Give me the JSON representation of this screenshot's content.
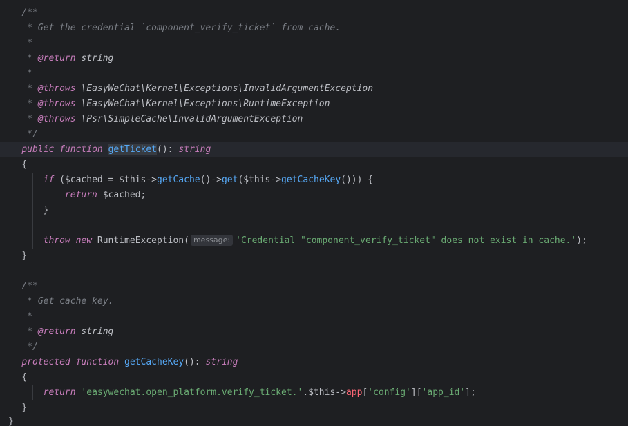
{
  "editor": {
    "language": "PHP",
    "doc1": {
      "open": "/**",
      "summary": " * Get the credential `component_verify_ticket` from cache.",
      "blank": " *",
      "star": " * ",
      "return_tag": "@return",
      "return_type": " string",
      "throws_tag": "@throws",
      "throws1": " \\EasyWeChat\\Kernel\\Exceptions\\InvalidArgumentException",
      "throws2": " \\EasyWeChat\\Kernel\\Exceptions\\RuntimeException",
      "throws3": " \\Psr\\SimpleCache\\InvalidArgumentException",
      "close": " */"
    },
    "method1": {
      "visibility": "public",
      "function_kw": "function",
      "name": "getTicket",
      "sig_rest": "(): ",
      "return_type": "string",
      "open_brace": "{",
      "if_kw": "if",
      "if_open": " ($cached = $this->",
      "get_cache": "getCache",
      "arrow": "()->",
      "get": "get",
      "this_arrow": "($this->",
      "get_cache_key": "getCacheKey",
      "if_close": "())) {",
      "return_kw": "return",
      "return_val": " $cached;",
      "close_if": "}",
      "throw_kw": "throw",
      "new_kw": "new",
      "exception_class": "RuntimeException(",
      "param_hint": "message:",
      "message": "'Credential \"component_verify_ticket\" does not exist in cache.'",
      "throw_end": ");",
      "close_brace": "}"
    },
    "doc2": {
      "open": "/**",
      "summary": " * Get cache key.",
      "blank": " *",
      "star": " * ",
      "return_tag": "@return",
      "return_type": " string",
      "close": " */"
    },
    "method2": {
      "visibility": "protected",
      "function_kw": "function",
      "name": "getCacheKey",
      "sig_rest": "(): ",
      "return_type": "string",
      "open_brace": "{",
      "return_kw": "return",
      "key_string": "'easywechat.open_platform.verify_ticket.'",
      "concat": ".$this->",
      "app": "app",
      "lbr": "[",
      "config_key": "'config'",
      "mid": "][",
      "app_id_key": "'app_id'",
      "end": "];",
      "close_brace": "}"
    },
    "class_close": "}"
  }
}
